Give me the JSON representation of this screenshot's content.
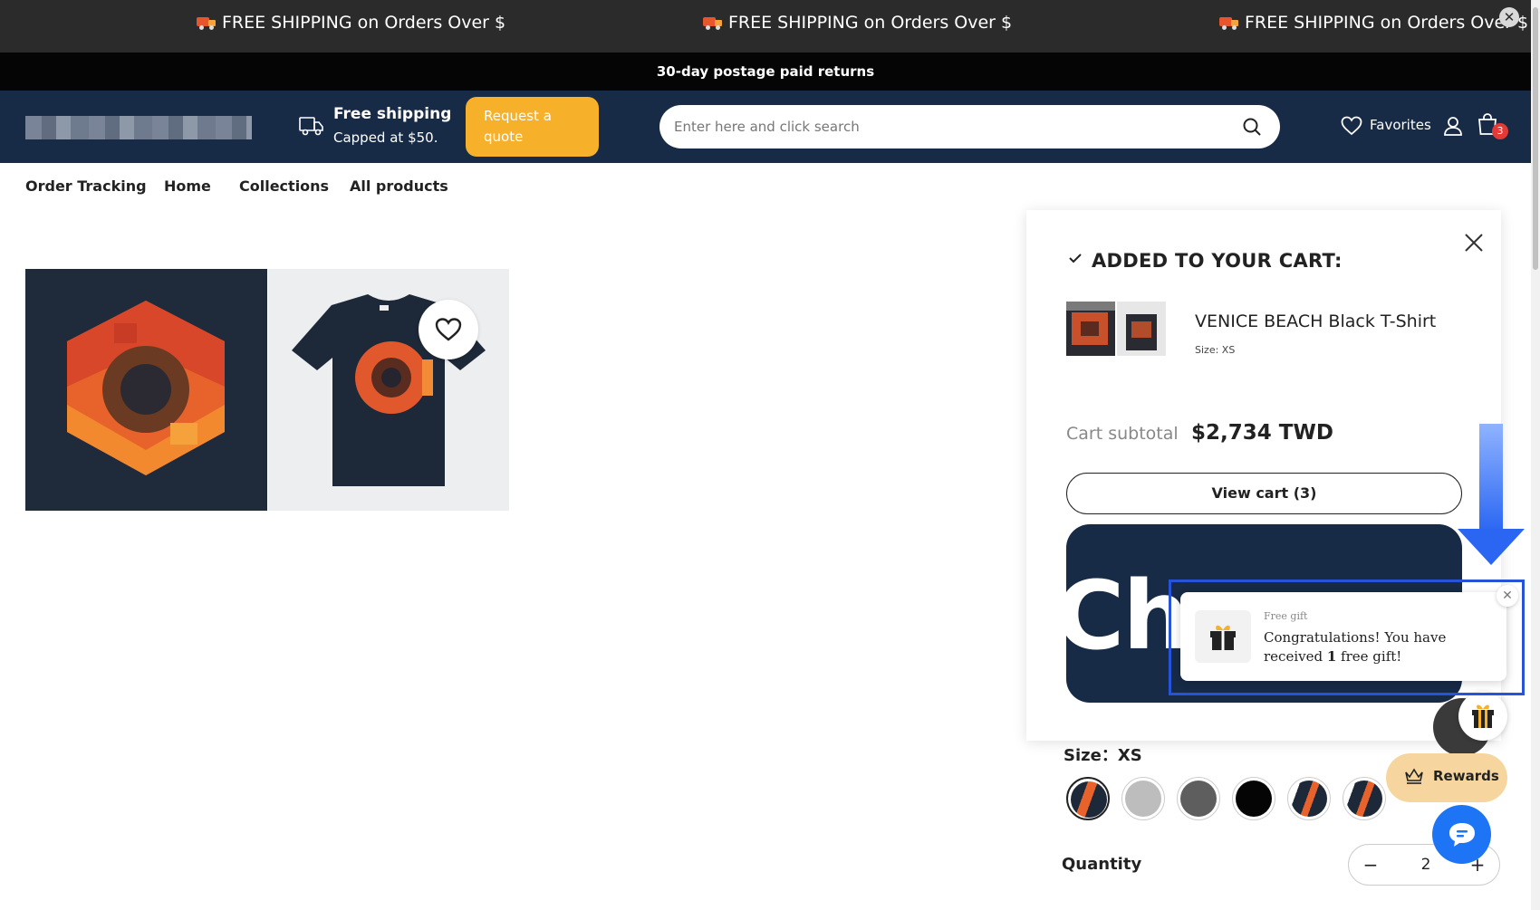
{
  "marquee": {
    "items": [
      "FREE SHIPPING on Orders Over $",
      "FREE SHIPPING on Orders Over $",
      "FREE SHIPPING on Orders Over $"
    ],
    "close_glyph": "✕"
  },
  "returns_bar": {
    "text": "30-day postage paid returns"
  },
  "header": {
    "shipping_title": "Free shipping",
    "shipping_sub": "Capped at $50.",
    "quote_button": "Request a quote",
    "search_placeholder": "Enter here and click search",
    "favorites_label": "Favorites",
    "cart_count": "3"
  },
  "nav": {
    "items": [
      "Order Tracking",
      "Home",
      "Collections",
      "All products"
    ]
  },
  "cart_drawer": {
    "title": "ADDED TO YOUR CART:",
    "item_name": "VENICE BEACH Black T-Shirt",
    "item_size": "Size: XS",
    "subtotal_label": "Cart subtotal",
    "subtotal_value": "$2,734 TWD",
    "view_cart_label": "View cart (3)",
    "checkout_label": "Che"
  },
  "gift_toast": {
    "kicker": "Free gift",
    "message_pre": "Congratulations! You have received ",
    "message_bold": "1",
    "message_post": " free gift!",
    "close_glyph": "✕"
  },
  "rewards": {
    "label": "Rewards"
  },
  "product": {
    "size_label": "Size：XS",
    "quantity_label": "Quantity",
    "quantity_value": "2",
    "minus_glyph": "−",
    "plus_glyph": "+"
  },
  "colors": {
    "header_bg": "#172a46",
    "accent_yellow": "#f6b02a",
    "badge_red": "#e53935",
    "annotation_blue": "#2753d8",
    "chat_blue": "#1d74f5"
  }
}
